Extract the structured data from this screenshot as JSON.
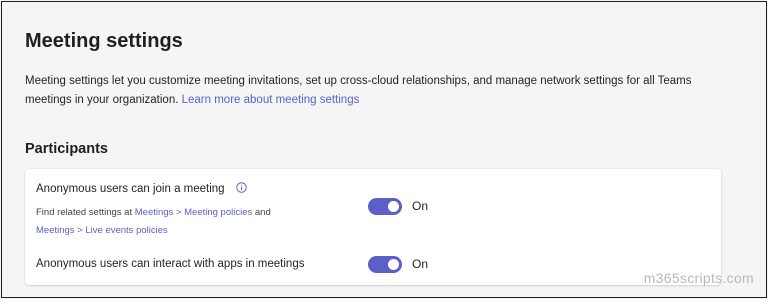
{
  "page": {
    "title": "Meeting settings",
    "description_text": "Meeting settings let you customize meeting invitations, set up cross-cloud relationships, and manage network settings for all Teams meetings in your organization. ",
    "learn_more_link": "Learn more about meeting settings"
  },
  "participants": {
    "title": "Participants",
    "settings": [
      {
        "label": "Anonymous users can join a meeting",
        "info_icon": "info-icon",
        "helper_prefix": "Find related settings at ",
        "helper_link1": "Meetings > Meeting policies",
        "helper_mid": " and",
        "helper_link2": "Meetings > Live events policies",
        "toggle_state": "On",
        "toggle_on": true
      },
      {
        "label": "Anonymous users can interact with apps in meetings",
        "toggle_state": "On",
        "toggle_on": true
      }
    ]
  },
  "watermark": "m365scripts.com",
  "colors": {
    "accent": "#5b5fc7",
    "background": "#f5f5f5",
    "card": "#ffffff"
  }
}
